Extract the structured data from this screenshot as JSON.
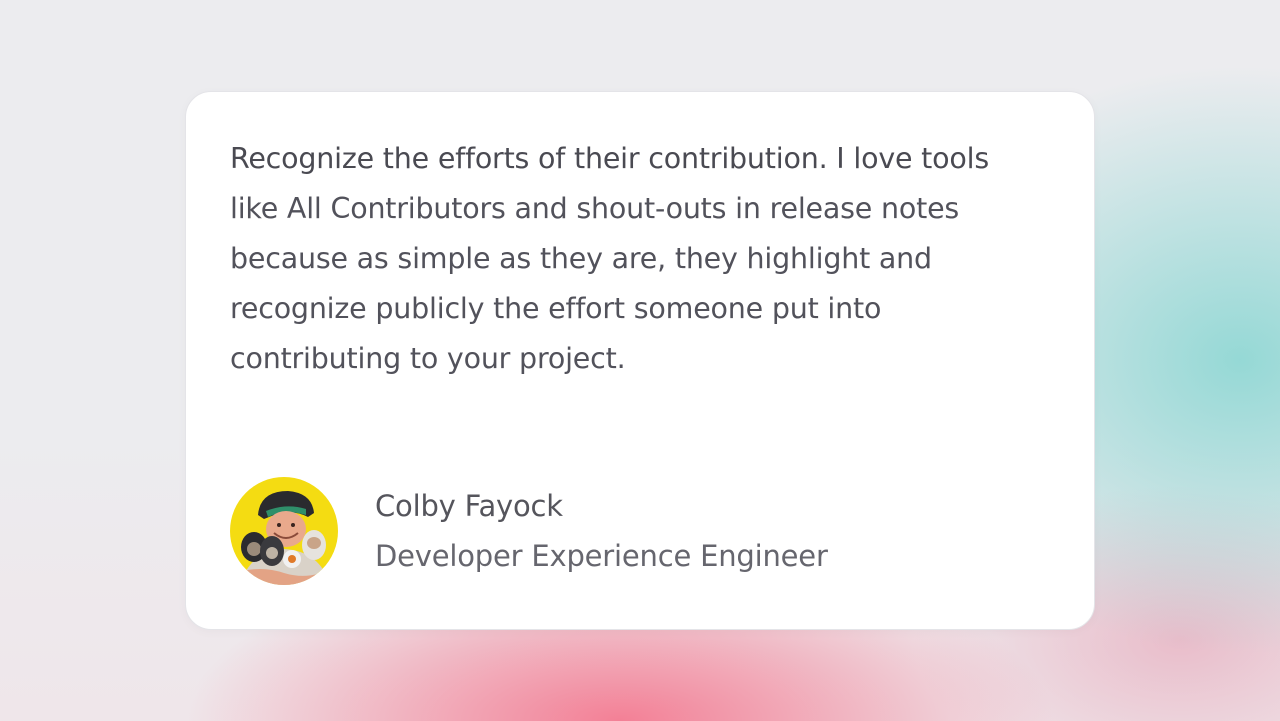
{
  "testimonial": {
    "quote_lines": [
      "Recognize the efforts of their contribution. I love tools",
      "like All Contributors and shout-outs in release notes",
      "because as simple as they are, they highlight and",
      "recognize publicly the effort someone put into",
      "contributing to your project."
    ],
    "author": {
      "name": "Colby Fayock",
      "role": "Developer Experience Engineer",
      "avatar_background": "#f4dc12"
    }
  },
  "colors": {
    "card_background": "#ffffff",
    "text": "#52525b",
    "accent_teal": "#78d2cd",
    "accent_pink": "#f46e87"
  }
}
